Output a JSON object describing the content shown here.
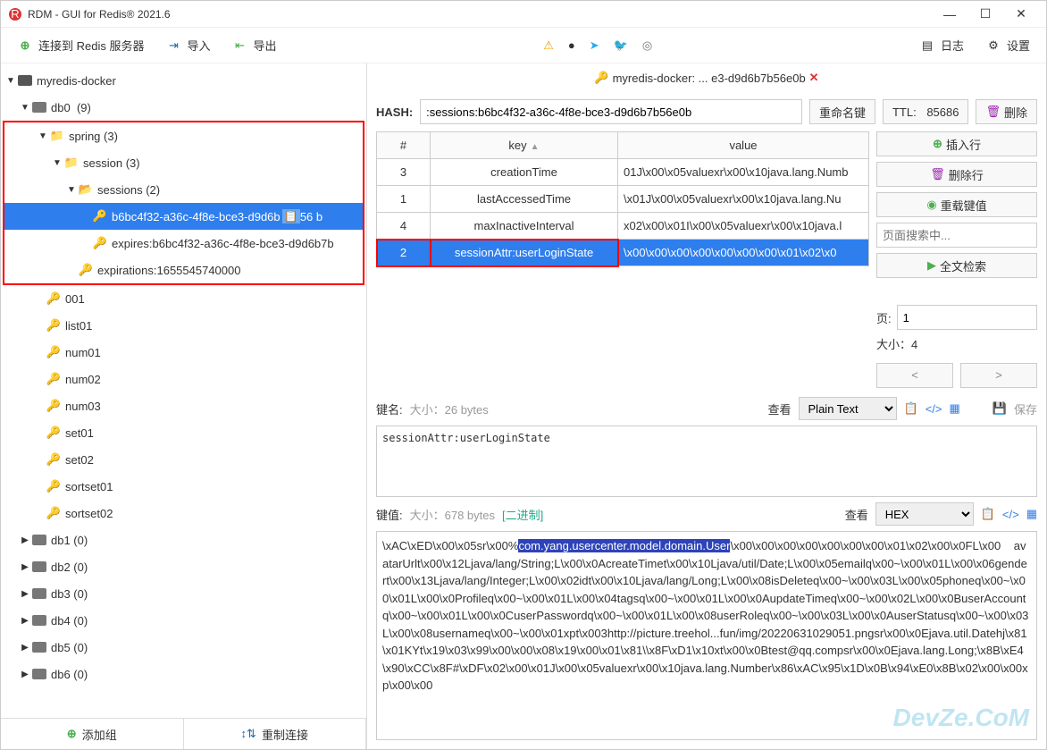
{
  "title": "RDM - GUI for Redis® 2021.6",
  "toolbar": {
    "connect": "连接到 Redis 服务器",
    "import": "导入",
    "export": "导出",
    "log": "日志",
    "settings": "设置"
  },
  "tree": {
    "server": "myredis-docker",
    "db0": {
      "label": "db0",
      "count": "(9)"
    },
    "spring": {
      "label": "spring",
      "count": "(3)"
    },
    "session": {
      "label": "session",
      "count": "(3)"
    },
    "sessions": {
      "label": "sessions",
      "count": "(2)"
    },
    "sel_key": "b6bc4f32-a36c-4f8e-bce3-d9d6b",
    "sel_key_suffix": "56   b",
    "expires": "expires:b6bc4f32-a36c-4f8e-bce3-d9d6b7b",
    "expirations": "expirations:1655545740000",
    "keys": [
      "001",
      "list01",
      "num01",
      "num02",
      "num03",
      "set01",
      "set02",
      "sortset01",
      "sortset02"
    ],
    "dbs": [
      "db1  (0)",
      "db2  (0)",
      "db3  (0)",
      "db4  (0)",
      "db5  (0)",
      "db6  (0)"
    ]
  },
  "sidebarFooter": {
    "addgroup": "添加组",
    "reconnect": "重制连接"
  },
  "tab": {
    "icon": "key",
    "label": "myredis-docker: ... e3-d9d6b7b56e0b"
  },
  "keyRow": {
    "type": "HASH:",
    "name": ":sessions:b6bc4f32-a36c-4f8e-bce3-d9d6b7b56e0b",
    "rename": "重命名键",
    "ttl_lbl": "TTL:",
    "ttl": "85686",
    "delete": "删除"
  },
  "tableHead": {
    "idx": "#",
    "key": "key",
    "value": "value"
  },
  "rows": [
    {
      "i": "3",
      "k": "creationTime",
      "v": "01J\\x00\\x05valuexr\\x00\\x10java.lang.Numb"
    },
    {
      "i": "1",
      "k": "lastAccessedTime",
      "v": "\\x01J\\x00\\x05valuexr\\x00\\x10java.lang.Nu"
    },
    {
      "i": "4",
      "k": "maxInactiveInterval",
      "v": "x02\\x00\\x01I\\x00\\x05valuexr\\x00\\x10java.l"
    },
    {
      "i": "2",
      "k": "sessionAttr:userLoginState",
      "v": "\\x00\\x00\\x00\\x00\\x00\\x00\\x00\\x01\\x02\\x0"
    }
  ],
  "rightCol": {
    "insert": "插入行",
    "deleteRow": "删除行",
    "reload": "重载键值",
    "searchPH": "页面搜索中...",
    "fulltext": "全文检索",
    "pageLbl": "页:",
    "page": "1",
    "sizeLbl": "大小：",
    "size": "4"
  },
  "keyView": {
    "lbl": "键名:",
    "size": "大小：26 bytes",
    "viewLbl": "查看",
    "mode": "Plain Text",
    "save": "保存",
    "content": "sessionAttr:userLoginState"
  },
  "valView": {
    "lbl": "键值:",
    "size": "大小：678 bytes",
    "bin": "[二进制]",
    "viewLbl": "查看",
    "mode": "HEX",
    "pre": "\\xAC\\xED\\x00\\x05sr\\x00%",
    "hl": "com.yang.usercenter.model.domain.User",
    "post": "\\x00\\x00\\x00\\x00\\x00\\x00\\x00\\x01\\x02\\x00\\x0FL\\x00    avatarUrlt\\x00\\x12Ljava/lang/String;L\\x00\\x0AcreateTimet\\x00\\x10Ljava/util/Date;L\\x00\\x05emailq\\x00~\\x00\\x01L\\x00\\x06gendert\\x00\\x13Ljava/lang/Integer;L\\x00\\x02idt\\x00\\x10Ljava/lang/Long;L\\x00\\x08isDeleteq\\x00~\\x00\\x03L\\x00\\x05phoneq\\x00~\\x00\\x01L\\x00\\x0Profileq\\x00~\\x00\\x01L\\x00\\x04tagsq\\x00~\\x00\\x01L\\x00\\x0AupdateTimeq\\x00~\\x00\\x02L\\x00\\x0BuserAccountq\\x00~\\x00\\x01L\\x00\\x0CuserPasswordq\\x00~\\x00\\x01L\\x00\\x08userRoleq\\x00~\\x00\\x03L\\x00\\x0AuserStatusq\\x00~\\x00\\x03L\\x00\\x08usernameq\\x00~\\x00\\x01xpt\\x003http://picture.treehol...fun/img/20220631029051.pngsr\\x00\\x0Ejava.util.Datehj\\x81\\x01KYt\\x19\\x03\\x99\\x00\\x00\\x08\\x19\\x00\\x01\\x81\\\\x8F\\xD1\\x10xt\\x00\\x0Btest@qq.compsr\\x00\\x0Ejava.lang.Long;\\x8B\\xE4\\x90\\xCC\\x8F#\\xDF\\x02\\x00\\x01J\\x00\\x05valuexr\\x00\\x10java.lang.Number\\x86\\xAC\\x95\\x1D\\x0B\\x94\\xE0\\x8B\\x02\\x00\\x00xp\\x00\\x00"
  },
  "watermark": "DevZe.CoM"
}
